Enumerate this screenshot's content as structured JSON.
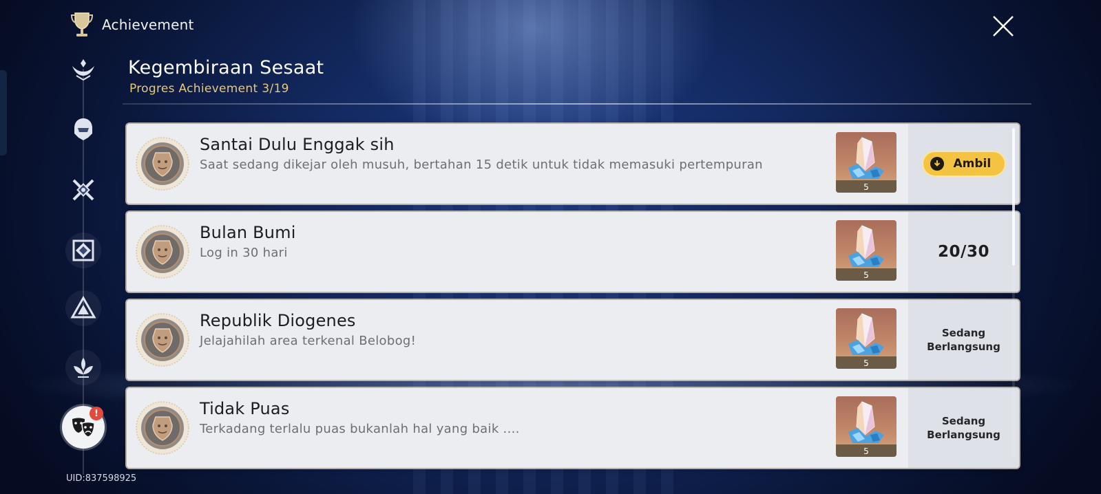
{
  "header": {
    "title": "Achievement",
    "icon": "trophy-icon"
  },
  "close": {
    "icon": "close-icon"
  },
  "nav": {
    "items": [
      {
        "icon": "hands-crest-icon"
      },
      {
        "icon": "helmet-crest-icon"
      },
      {
        "icon": "crossed-swords-icon"
      },
      {
        "icon": "diamond-emblem-icon"
      },
      {
        "icon": "triangle-emblem-icon"
      },
      {
        "icon": "lotus-emblem-icon"
      },
      {
        "icon": "theater-masks-icon",
        "active": true,
        "badge": "!"
      }
    ]
  },
  "uid": "UID:837598925",
  "category": {
    "title": "Kegembiraan Sesaat",
    "progress_label": "Progres Achievement",
    "progress_value": "3/19"
  },
  "achievements": [
    {
      "name": "Santai Dulu Enggak sih",
      "desc": "Saat sedang dikejar oleh musuh, bertahan 15 detik untuk tidak memasuki pertempuran",
      "reward_qty": "5",
      "status_type": "claim",
      "claim_label": "Ambil"
    },
    {
      "name": "Bulan Bumi",
      "desc": "Log in 30 hari",
      "reward_qty": "5",
      "status_type": "count",
      "count": "20/30"
    },
    {
      "name": "Republik Diogenes",
      "desc": "Jelajahilah area terkenal Belobog!",
      "reward_qty": "5",
      "status_type": "ongoing",
      "status_line1": "Sedang",
      "status_line2": "Berlangsung"
    },
    {
      "name": "Tidak Puas",
      "desc": "Terkadang terlalu puas bukanlah hal yang baik ....",
      "reward_qty": "5",
      "status_type": "ongoing",
      "status_line1": "Sedang",
      "status_line2": "Berlangsung"
    }
  ],
  "colors": {
    "accent_gold": "#e8c97a",
    "claim_button": "#f5c342",
    "badge": "#e34a3c"
  }
}
